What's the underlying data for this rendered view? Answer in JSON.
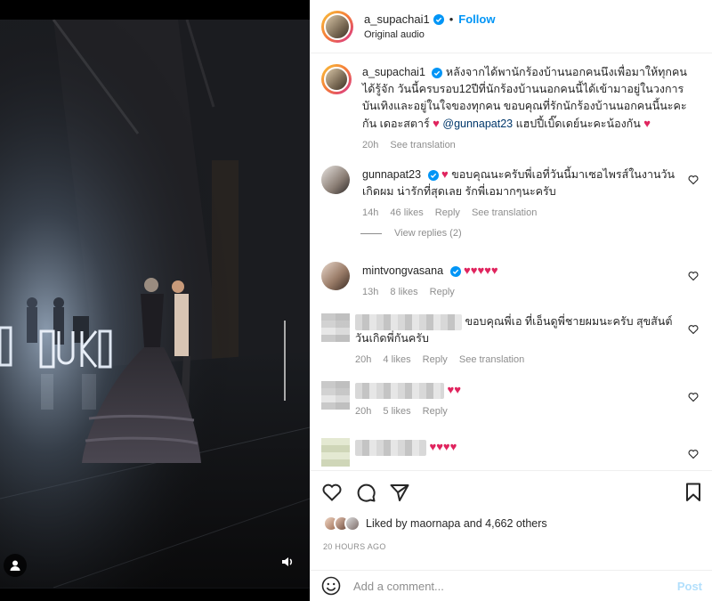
{
  "post": {
    "username": "a_supachai1",
    "follow_label": "Follow",
    "separator": "•",
    "audio": "Original audio"
  },
  "caption": {
    "username": "a_supachai1",
    "text": "หลังจากได้พานักร้องบ้านนอกคนนึงเพื่อมาให้ทุกคนได้รู้จัก วันนี้ครบรอบ12ปีที่นักร้องบ้านนอกคนนี้ได้เข้ามาอยู่ในวงการบันเทิงและอยู่ในใจของทุกคน ขอบคุณที่รักนักร้องบ้านนอกคนนี้นะคะ กัน เดอะสตาร์",
    "mention": "@gunnapat23",
    "text2": "แฮปปี้เบิ๊ดเดย์นะคะน้องกัน",
    "heart": "♥",
    "time": "20h",
    "see_translation": "See translation"
  },
  "comments": [
    {
      "username": "gunnapat23",
      "heart": "♥",
      "text": "ขอบคุณนะครับพี่เอที่วันนี้มาเซอไพรส์ในงานวันเกิดผม น่ารักที่สุดเลย รักพี่เอมากๆนะครับ",
      "time": "14h",
      "likes": "46 likes",
      "reply": "Reply",
      "see_translation": "See translation"
    },
    {
      "username": "mintvongvasana",
      "hearts": "♥♥♥♥♥",
      "time": "13h",
      "likes": "8 likes",
      "reply": "Reply"
    },
    {
      "text": "ขอบคุณพี่เอ ที่เอ็นดูพี่ชายผมนะครับ สุขสันต์วันเกิดพี่กันครับ",
      "time": "20h",
      "likes": "4 likes",
      "reply": "Reply",
      "see_translation": "See translation"
    },
    {
      "hearts": "♥♥",
      "time": "20h",
      "likes": "5 likes",
      "reply": "Reply"
    },
    {
      "hearts": "♥♥♥♥"
    }
  ],
  "view_replies": "View replies (2)",
  "actions": {
    "liked_prefix": "Liked by",
    "liked_user": "maornapa",
    "liked_and": "and",
    "liked_count": "4,662 others",
    "timestamp": "20 HOURS AGO"
  },
  "composer": {
    "placeholder": "Add a comment...",
    "post_label": "Post"
  },
  "colors": {
    "accent": "#0095f6",
    "heart": "#e0245e",
    "muted": "#8e8e8e"
  }
}
